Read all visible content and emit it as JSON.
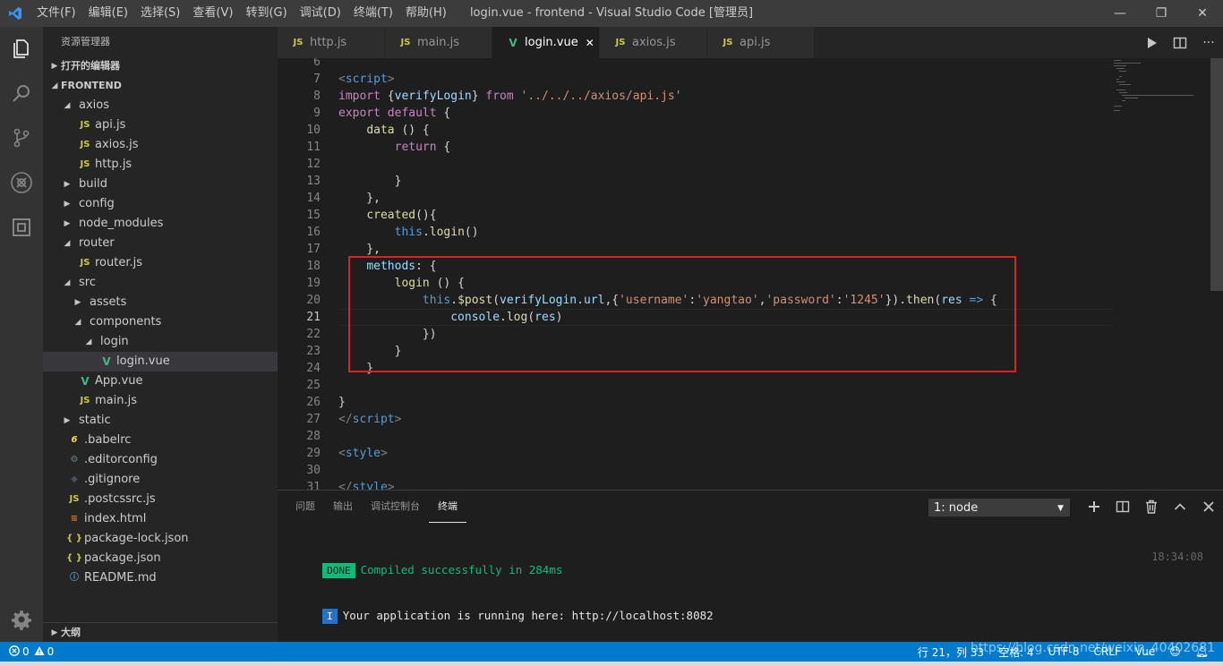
{
  "window": {
    "title": "login.vue - frontend - Visual Studio Code [管理员]",
    "menu": [
      "文件(F)",
      "编辑(E)",
      "选择(S)",
      "查看(V)",
      "转到(G)",
      "调试(D)",
      "终端(T)",
      "帮助(H)"
    ],
    "controls": {
      "minimize": "—",
      "restore": "❐",
      "close": "✕"
    }
  },
  "activity_bar": {
    "icons": [
      "files-icon",
      "search-icon",
      "source-control-icon",
      "debug-icon",
      "extensions-icon",
      "settings-icon"
    ]
  },
  "sidebar": {
    "title": "资源管理器",
    "open_editors": "打开的编辑器",
    "project": "FRONTEND",
    "tree": [
      {
        "label": "axios",
        "type": "folder",
        "open": true,
        "depth": 1
      },
      {
        "label": "api.js",
        "type": "js",
        "depth": 2
      },
      {
        "label": "axios.js",
        "type": "js",
        "depth": 2
      },
      {
        "label": "http.js",
        "type": "js",
        "depth": 2
      },
      {
        "label": "build",
        "type": "folder",
        "open": false,
        "depth": 1
      },
      {
        "label": "config",
        "type": "folder",
        "open": false,
        "depth": 1
      },
      {
        "label": "node_modules",
        "type": "folder",
        "open": false,
        "depth": 1
      },
      {
        "label": "router",
        "type": "folder",
        "open": true,
        "depth": 1
      },
      {
        "label": "router.js",
        "type": "js",
        "depth": 2
      },
      {
        "label": "src",
        "type": "folder",
        "open": true,
        "depth": 1
      },
      {
        "label": "assets",
        "type": "folder",
        "open": false,
        "depth": 2
      },
      {
        "label": "components",
        "type": "folder",
        "open": true,
        "depth": 2
      },
      {
        "label": "login",
        "type": "folder",
        "open": true,
        "depth": 3
      },
      {
        "label": "login.vue",
        "type": "vue",
        "depth": 4,
        "selected": true
      },
      {
        "label": "App.vue",
        "type": "vue",
        "depth": 2
      },
      {
        "label": "main.js",
        "type": "js",
        "depth": 2
      },
      {
        "label": "static",
        "type": "folder",
        "open": false,
        "depth": 1
      },
      {
        "label": ".babelrc",
        "type": "babel",
        "depth": 1
      },
      {
        "label": ".editorconfig",
        "type": "gear",
        "depth": 1
      },
      {
        "label": ".gitignore",
        "type": "git",
        "depth": 1
      },
      {
        "label": ".postcssrc.js",
        "type": "js",
        "depth": 1
      },
      {
        "label": "index.html",
        "type": "html",
        "depth": 1
      },
      {
        "label": "package-lock.json",
        "type": "json",
        "depth": 1
      },
      {
        "label": "package.json",
        "type": "json",
        "depth": 1
      },
      {
        "label": "README.md",
        "type": "info",
        "depth": 1
      }
    ],
    "outline": "大纲"
  },
  "tabs": [
    {
      "label": "http.js",
      "type": "js",
      "active": false
    },
    {
      "label": "main.js",
      "type": "js",
      "active": false
    },
    {
      "label": "login.vue",
      "type": "vue",
      "active": true
    },
    {
      "label": "axios.js",
      "type": "js",
      "active": false
    },
    {
      "label": "api.js",
      "type": "js",
      "active": false
    }
  ],
  "editor": {
    "current_line": 21,
    "lines": [
      {
        "n": 6,
        "tokens": []
      },
      {
        "n": 7,
        "tokens": [
          [
            "tag",
            "<"
          ],
          [
            "tagname",
            "script"
          ],
          [
            "tag",
            ">"
          ]
        ]
      },
      {
        "n": 8,
        "tokens": [
          [
            "kw",
            "import"
          ],
          [
            "punc",
            " {"
          ],
          [
            "var",
            "verifyLogin"
          ],
          [
            "punc",
            "} "
          ],
          [
            "kw",
            "from"
          ],
          [
            "punc",
            " "
          ],
          [
            "str",
            "'../../../axios/api.js'"
          ]
        ]
      },
      {
        "n": 9,
        "tokens": [
          [
            "kw",
            "export"
          ],
          [
            "punc",
            " "
          ],
          [
            "kw",
            "default"
          ],
          [
            "punc",
            " {"
          ]
        ]
      },
      {
        "n": 10,
        "tokens": [
          [
            "punc",
            "    "
          ],
          [
            "fn",
            "data"
          ],
          [
            "punc",
            " () {"
          ]
        ]
      },
      {
        "n": 11,
        "tokens": [
          [
            "punc",
            "        "
          ],
          [
            "kw",
            "return"
          ],
          [
            "punc",
            " {"
          ]
        ]
      },
      {
        "n": 12,
        "tokens": []
      },
      {
        "n": 13,
        "tokens": [
          [
            "punc",
            "        }"
          ]
        ]
      },
      {
        "n": 14,
        "tokens": [
          [
            "punc",
            "    },"
          ]
        ]
      },
      {
        "n": 15,
        "tokens": [
          [
            "punc",
            "    "
          ],
          [
            "fn",
            "created"
          ],
          [
            "punc",
            "(){"
          ]
        ]
      },
      {
        "n": 16,
        "tokens": [
          [
            "punc",
            "        "
          ],
          [
            "kw2",
            "this"
          ],
          [
            "punc",
            "."
          ],
          [
            "fn",
            "login"
          ],
          [
            "punc",
            "()"
          ]
        ]
      },
      {
        "n": 17,
        "tokens": [
          [
            "punc",
            "    },"
          ]
        ]
      },
      {
        "n": 18,
        "tokens": [
          [
            "punc",
            "    "
          ],
          [
            "var",
            "methods"
          ],
          [
            "punc",
            ": {"
          ]
        ]
      },
      {
        "n": 19,
        "tokens": [
          [
            "punc",
            "        "
          ],
          [
            "fn",
            "login"
          ],
          [
            "punc",
            " () {"
          ]
        ]
      },
      {
        "n": 20,
        "tokens": [
          [
            "punc",
            "            "
          ],
          [
            "kw2",
            "this"
          ],
          [
            "punc",
            "."
          ],
          [
            "fn",
            "$post"
          ],
          [
            "punc",
            "("
          ],
          [
            "var",
            "verifyLogin"
          ],
          [
            "punc",
            "."
          ],
          [
            "var",
            "url"
          ],
          [
            "punc",
            ",{"
          ],
          [
            "str",
            "'username'"
          ],
          [
            "punc",
            ":"
          ],
          [
            "str",
            "'yangtao'"
          ],
          [
            "punc",
            ","
          ],
          [
            "str",
            "'password'"
          ],
          [
            "punc",
            ":"
          ],
          [
            "str",
            "'1245'"
          ],
          [
            "punc",
            "})."
          ],
          [
            "fn",
            "then"
          ],
          [
            "punc",
            "("
          ],
          [
            "var",
            "res"
          ],
          [
            "punc",
            " "
          ],
          [
            "kw2",
            "=>"
          ],
          [
            "punc",
            " {"
          ]
        ]
      },
      {
        "n": 21,
        "tokens": [
          [
            "punc",
            "                "
          ],
          [
            "var",
            "console"
          ],
          [
            "punc",
            "."
          ],
          [
            "fn",
            "log"
          ],
          [
            "punc",
            "("
          ],
          [
            "var",
            "res"
          ],
          [
            "punc",
            ")"
          ]
        ]
      },
      {
        "n": 22,
        "tokens": [
          [
            "punc",
            "            })"
          ]
        ]
      },
      {
        "n": 23,
        "tokens": [
          [
            "punc",
            "        }"
          ]
        ]
      },
      {
        "n": 24,
        "tokens": [
          [
            "punc",
            "    }"
          ]
        ]
      },
      {
        "n": 25,
        "tokens": []
      },
      {
        "n": 26,
        "tokens": [
          [
            "punc",
            "}"
          ]
        ]
      },
      {
        "n": 27,
        "tokens": [
          [
            "tag",
            "</"
          ],
          [
            "tagname",
            "script"
          ],
          [
            "tag",
            ">"
          ]
        ]
      },
      {
        "n": 28,
        "tokens": []
      },
      {
        "n": 29,
        "tokens": [
          [
            "tag",
            "<"
          ],
          [
            "tagname",
            "style"
          ],
          [
            "tag",
            ">"
          ]
        ]
      },
      {
        "n": 30,
        "tokens": []
      },
      {
        "n": 31,
        "tokens": [
          [
            "tag",
            "</"
          ],
          [
            "tagname",
            "style"
          ],
          [
            "tag",
            ">"
          ]
        ]
      }
    ]
  },
  "panel": {
    "tabs": [
      {
        "label": "问题",
        "active": false
      },
      {
        "label": "输出",
        "active": false
      },
      {
        "label": "调试控制台",
        "active": false
      },
      {
        "label": "终端",
        "active": true
      }
    ],
    "terminal_select": "1: node",
    "done_badge": "DONE",
    "compiled_message": "Compiled successfully in 284ms",
    "time": "18:34:08",
    "info_badge": "I",
    "running_message": "Your application is running here: http://localhost:8082"
  },
  "status_bar": {
    "errors": "0",
    "warnings": "0",
    "position": "行 21，列 33",
    "spaces": "空格: 4",
    "encoding": "UTF-8",
    "eol": "CRLF",
    "language": "Vue"
  },
  "watermark": "https://blog.csdn.net/weixin_40402681"
}
